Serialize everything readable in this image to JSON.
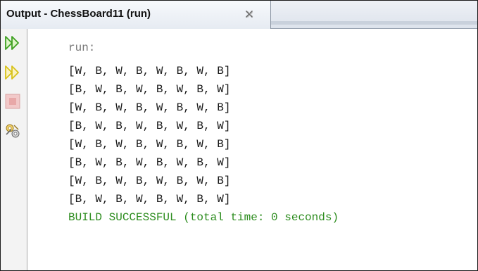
{
  "tab": {
    "title": "Output - ChessBoard11 (run)",
    "close_icon": "close-icon"
  },
  "toolbar": {
    "items": [
      {
        "name": "rerun-icon",
        "color": "#3da01f"
      },
      {
        "name": "rerun-with-options-icon",
        "color": "#d8c21a"
      },
      {
        "name": "stop-icon",
        "color": "#e3a0a0"
      },
      {
        "name": "settings-icon",
        "color": "#8c8c8c"
      }
    ]
  },
  "console": {
    "run_label": "run:",
    "rows": [
      "[W, B, W, B, W, B, W, B]",
      "[B, W, B, W, B, W, B, W]",
      "[W, B, W, B, W, B, W, B]",
      "[B, W, B, W, B, W, B, W]",
      "[W, B, W, B, W, B, W, B]",
      "[B, W, B, W, B, W, B, W]",
      "[W, B, W, B, W, B, W, B]",
      "[B, W, B, W, B, W, B, W]"
    ],
    "status": "BUILD SUCCESSFUL (total time: 0 seconds)",
    "status_color": "#2c8c1e"
  }
}
